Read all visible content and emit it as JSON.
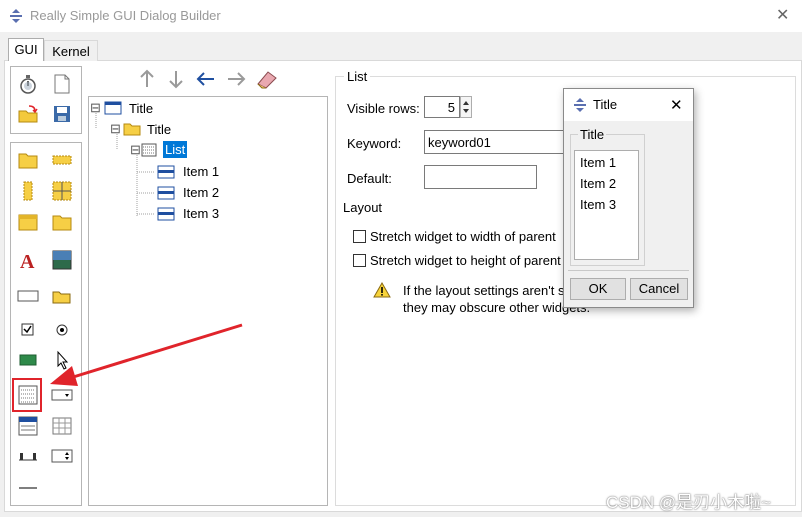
{
  "window": {
    "title": "Really Simple GUI Dialog Builder",
    "close_glyph": "✕"
  },
  "tabs": [
    {
      "label": "GUI"
    },
    {
      "label": "Kernel"
    }
  ],
  "tree": {
    "toolbar": {
      "up": "↑",
      "down": "↓",
      "left": "←",
      "right": "→"
    },
    "nodes": [
      {
        "label": "Title",
        "expander": "⊟"
      },
      {
        "label": "Title",
        "expander": "⊟"
      },
      {
        "label": "List",
        "expander": "⊟"
      },
      {
        "label": "Item 1"
      },
      {
        "label": "Item 2"
      },
      {
        "label": "Item 3"
      }
    ]
  },
  "properties": {
    "group_title": "List",
    "visible_rows_label": "Visible rows:",
    "visible_rows_value": "5",
    "keyword_label": "Keyword:",
    "keyword_value": "keyword01",
    "default_label": "Default:",
    "default_value": "",
    "layout_label": "Layout",
    "stretch_width_label": "Stretch widget to width of parent",
    "stretch_height_label": "Stretch widget to height of parent",
    "warning_line1": "If the layout settings aren't s",
    "warning_line2": "they may obscure other widgets."
  },
  "preview": {
    "title": "Title",
    "close_glyph": "✕",
    "group_title": "Title",
    "items": [
      "Item 1",
      "Item 2",
      "Item 3"
    ],
    "ok_label": "OK",
    "cancel_label": "Cancel"
  },
  "watermark": "CSDN @是刃小木啦~",
  "icons": {
    "app": "app-icon",
    "timer": "stopwatch-icon",
    "new": "new-file-icon",
    "open": "open-folder-icon",
    "save": "save-icon"
  },
  "colors": {
    "accent": "#0078d7",
    "annotation_red": "#e0242b"
  }
}
